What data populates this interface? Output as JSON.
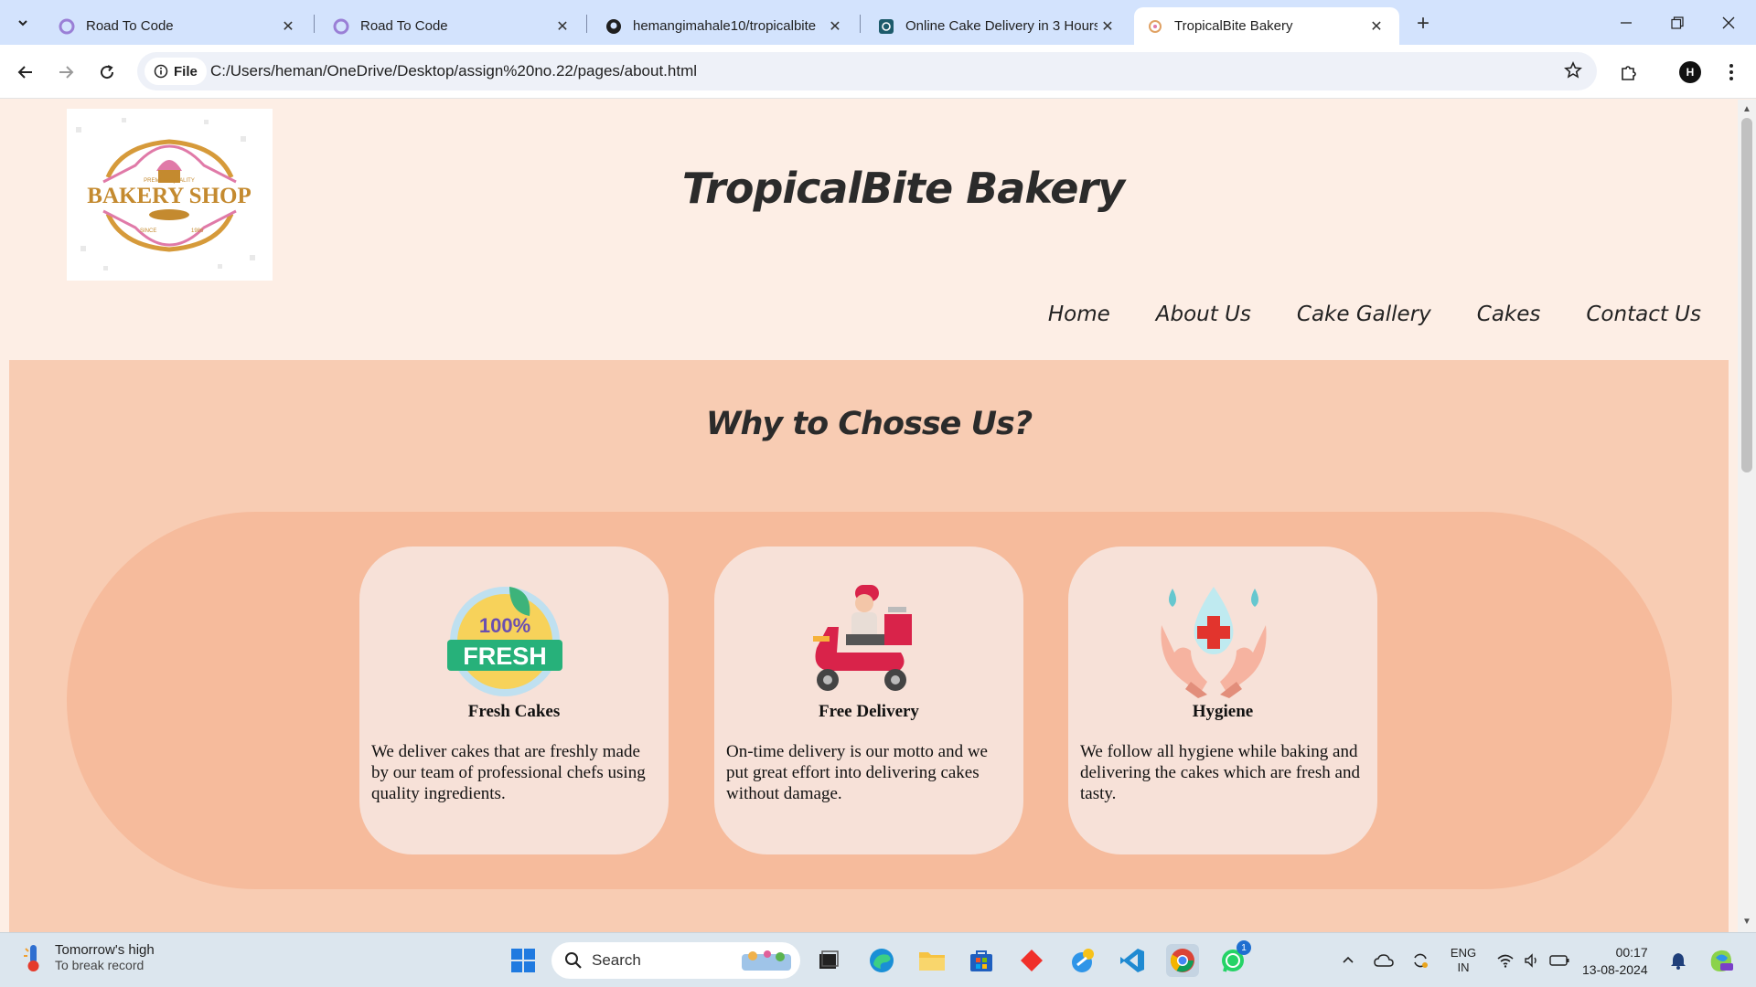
{
  "browser": {
    "tabs": [
      {
        "title": "Road To Code",
        "active": false
      },
      {
        "title": "Road To Code",
        "active": false
      },
      {
        "title": "hemangimahale10/tropicalbite",
        "active": false
      },
      {
        "title": "Online Cake Delivery in 3 Hours",
        "active": false
      },
      {
        "title": "TropicalBite Bakery",
        "active": true
      }
    ],
    "file_chip": "File",
    "url": "C:/Users/heman/OneDrive/Desktop/assign%20no.22/pages/about.html",
    "profile_initial": "H"
  },
  "site": {
    "logo_text": "BAKERY SHOP",
    "logo_small_top": "PREMIUM QUALITY",
    "logo_since": "SINCE",
    "logo_year": "1986",
    "title": "TropicalBite Bakery",
    "nav": [
      "Home",
      "About Us",
      "Cake Gallery",
      "Cakes",
      "Contact Us"
    ]
  },
  "why": {
    "heading": "Why to Chosse Us?",
    "cards": [
      {
        "title": "Fresh Cakes",
        "text": "We deliver cakes that are freshly made by our team of professional chefs using quality ingredients.",
        "icon": "fresh-badge-icon",
        "badge_top": "100%",
        "badge_bottom": "FRESH"
      },
      {
        "title": "Free Delivery",
        "text": "On-time delivery is our motto and we put great effort into delivering cakes without damage.",
        "icon": "scooter-delivery-icon"
      },
      {
        "title": "Hygiene",
        "text": "We follow all hygiene while baking and delivering the cakes which are fresh and tasty.",
        "icon": "hygiene-hands-icon"
      }
    ]
  },
  "taskbar": {
    "weather_title": "Tomorrow's high",
    "weather_sub": "To break record",
    "search_placeholder": "Search",
    "whatsapp_badge": "1",
    "lang_top": "ENG",
    "lang_bottom": "IN",
    "time": "00:17",
    "date": "13-08-2024"
  },
  "colors": {
    "page_bg": "#fdeee5",
    "section_bg": "#f8ccb3",
    "pill_bg": "#f6bb9c",
    "card_bg": "#f7e1d8",
    "tabstrip_bg": "#d3e3fd"
  }
}
